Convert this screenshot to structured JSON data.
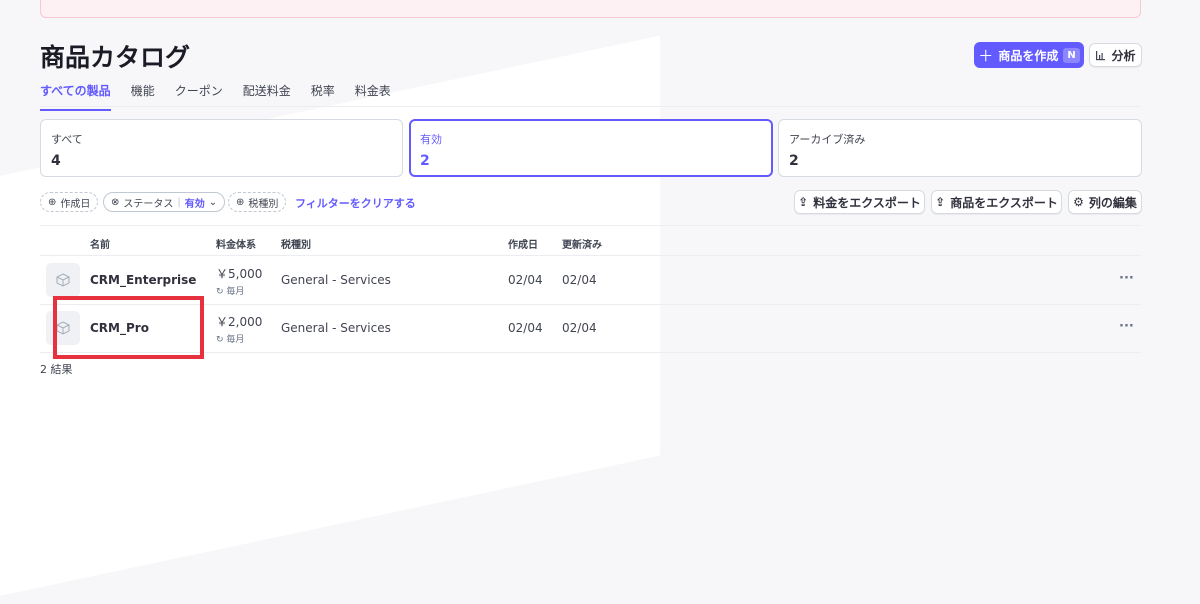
{
  "page": {
    "title": "商品カタログ",
    "create_button": {
      "label": "商品を作成",
      "shortcut": "N"
    },
    "analytics_button": {
      "label": "分析"
    }
  },
  "tabs": [
    {
      "label": "すべての製品",
      "active": true
    },
    {
      "label": "機能",
      "active": false
    },
    {
      "label": "クーポン",
      "active": false
    },
    {
      "label": "配送料金",
      "active": false
    },
    {
      "label": "税率",
      "active": false
    },
    {
      "label": "料金表",
      "active": false
    }
  ],
  "summary_cards": [
    {
      "label": "すべて",
      "count": "4",
      "active": false
    },
    {
      "label": "有効",
      "count": "2",
      "active": true
    },
    {
      "label": "アーカイブ済み",
      "count": "2",
      "active": false
    }
  ],
  "filters": {
    "created": "作成日",
    "status": {
      "label": "ステータス",
      "value": "有効"
    },
    "tax": "税種別",
    "clear": "フィルターをクリアする"
  },
  "actions": {
    "export_prices": "料金をエクスポート",
    "export_products": "商品をエクスポート",
    "edit_columns": "列の編集"
  },
  "table": {
    "headers": {
      "name": "名前",
      "pricing": "料金体系",
      "tax": "税種別",
      "created": "作成日",
      "updated": "更新済み"
    },
    "rows": [
      {
        "name": "CRM_Enterprise",
        "price": "￥5,000",
        "interval": "毎月",
        "tax": "General - Services",
        "created": "02/04",
        "updated": "02/04"
      },
      {
        "name": "CRM_Pro",
        "price": "￥2,000",
        "interval": "毎月",
        "tax": "General - Services",
        "created": "02/04",
        "updated": "02/04"
      }
    ]
  },
  "footer": {
    "results": "2 結果"
  },
  "colors": {
    "accent": "#635bff",
    "highlight": "#e8313f"
  }
}
